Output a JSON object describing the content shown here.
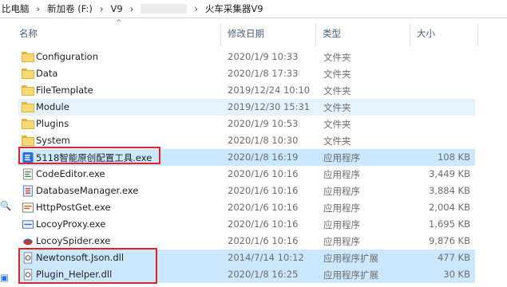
{
  "breadcrumb": [
    "比电脑",
    "新加卷 (F:)",
    "V9",
    "火车采集器V9"
  ],
  "columns": {
    "name": "名称",
    "date": "修改日期",
    "type": "类型",
    "size": "大小"
  },
  "files": [
    {
      "name": "Configuration",
      "date": "2020/1/9 10:33",
      "type": "文件夹",
      "size": "",
      "icon": "folder-icon"
    },
    {
      "name": "Data",
      "date": "2020/1/8 17:33",
      "type": "文件夹",
      "size": "",
      "icon": "folder-icon"
    },
    {
      "name": "FileTemplate",
      "date": "2019/12/24 10:10",
      "type": "文件夹",
      "size": "",
      "icon": "folder-icon"
    },
    {
      "name": "Module",
      "date": "2019/12/30 15:31",
      "type": "文件夹",
      "size": "",
      "icon": "folder-icon"
    },
    {
      "name": "Plugins",
      "date": "2020/1/9 10:53",
      "type": "文件夹",
      "size": "",
      "icon": "folder-icon"
    },
    {
      "name": "System",
      "date": "2020/1/8 10:30",
      "type": "文件夹",
      "size": "",
      "icon": "folder-icon"
    },
    {
      "name": "5118智能原创配置工具.exe",
      "date": "2020/1/8 16:19",
      "type": "应用程序",
      "size": "108 KB",
      "icon": "app-5118-icon"
    },
    {
      "name": "CodeEditor.exe",
      "date": "2020/1/6 10:16",
      "type": "应用程序",
      "size": "3,449 KB",
      "icon": "code-editor-icon"
    },
    {
      "name": "DatabaseManager.exe",
      "date": "2020/1/6 10:16",
      "type": "应用程序",
      "size": "3,884 KB",
      "icon": "database-icon"
    },
    {
      "name": "HttpPostGet.exe",
      "date": "2020/1/6 10:16",
      "type": "应用程序",
      "size": "2,004 KB",
      "icon": "http-icon"
    },
    {
      "name": "LocoyProxy.exe",
      "date": "2020/1/6 10:16",
      "type": "应用程序",
      "size": "1,695 KB",
      "icon": "proxy-icon"
    },
    {
      "name": "LocoySpider.exe",
      "date": "2020/1/6 10:16",
      "type": "应用程序",
      "size": "9,876 KB",
      "icon": "spider-icon"
    },
    {
      "name": "Newtonsoft.Json.dll",
      "date": "2014/7/14 10:12",
      "type": "应用程序扩展",
      "size": "477 KB",
      "icon": "dll-icon"
    },
    {
      "name": "Plugin_Helper.dll",
      "date": "2020/1/8 16:25",
      "type": "应用程序扩展",
      "size": "30 KB",
      "icon": "dll-icon"
    }
  ],
  "colors": {
    "selection": "#cce8ff",
    "highlight_box": "#e0222a",
    "folder": "#f8d775"
  }
}
